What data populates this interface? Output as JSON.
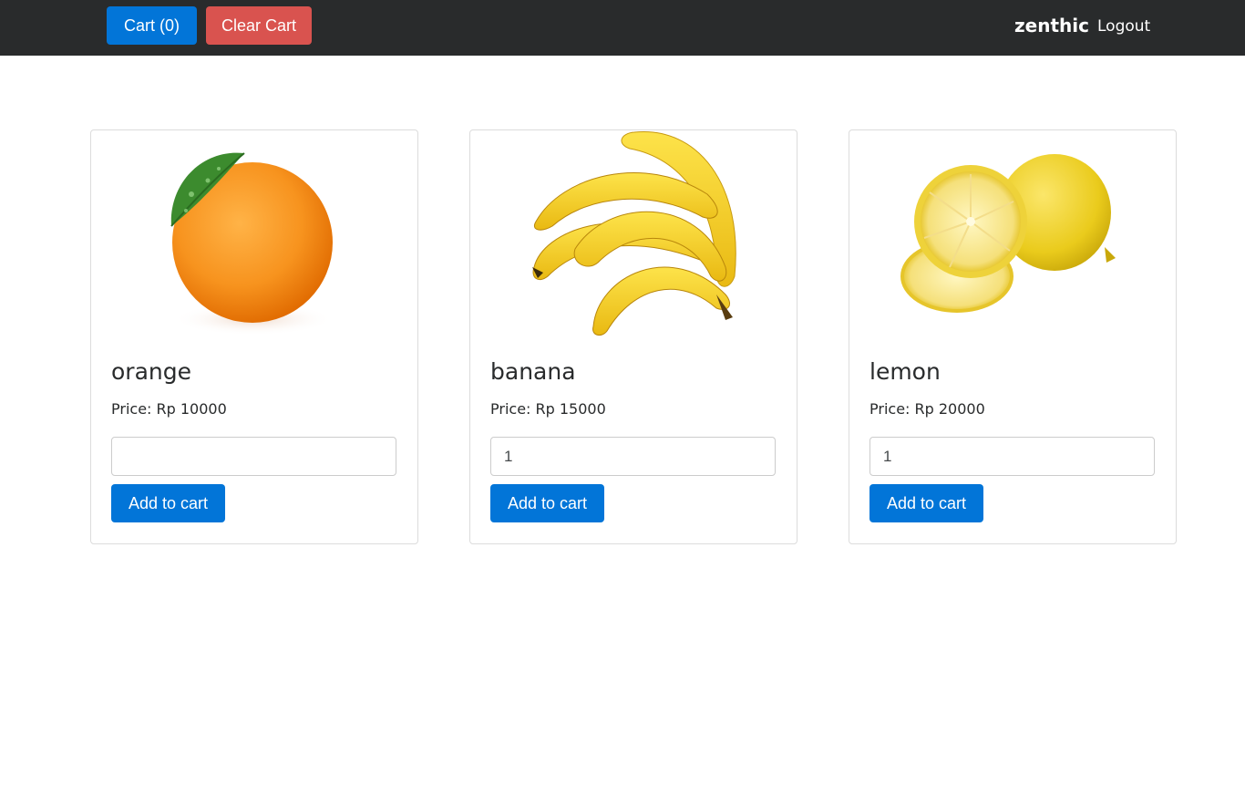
{
  "navbar": {
    "cart_label": "Cart (0)",
    "clear_label": "Clear Cart",
    "brand": "zenthic",
    "logout_label": "Logout",
    "background": "#292b2c"
  },
  "colors": {
    "primary": "#0275d8",
    "danger": "#d9534f"
  },
  "products": [
    {
      "name": "orange",
      "price_text": "Price: Rp 10000",
      "quantity": "",
      "add_label": "Add to cart",
      "image_icon": "orange-fruit-image"
    },
    {
      "name": "banana",
      "price_text": "Price: Rp 15000",
      "quantity": "1",
      "add_label": "Add to cart",
      "image_icon": "banana-fruit-image"
    },
    {
      "name": "lemon",
      "price_text": "Price: Rp 20000",
      "quantity": "1",
      "add_label": "Add to cart",
      "image_icon": "lemon-fruit-image"
    }
  ]
}
